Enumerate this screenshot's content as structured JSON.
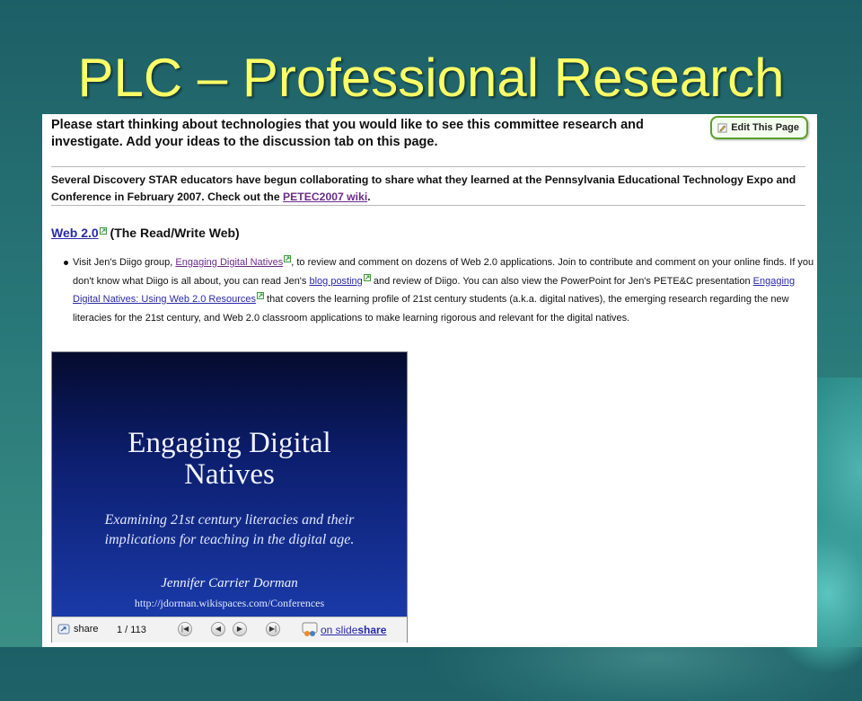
{
  "slide": {
    "title": "PLC – Professional Research"
  },
  "toolbar": {
    "edit_label": "Edit This Page"
  },
  "content": {
    "intro": "Please start thinking about technologies that you would like to see this committee research and investigate. Add your ideas to the discussion tab on this page.",
    "para2_before": "Several Discovery STAR educators have begun collaborating to share what they learned at the Pennsylvania Educational Technology Expo and Conference in February 2007. Check out the ",
    "para2_link": "PETEC2007 wiki",
    "para2_after": ".",
    "web20_link": "Web 2.0",
    "web20_rest": " (The Read/Write Web)",
    "bullet": {
      "t1": "Visit Jen's Diigo group, ",
      "l1": "Engaging Digital Natives",
      "t2": ", to review and comment on dozens of Web 2.0 applications. Join to contribute and comment on your online finds. If you don't know what Diigo is all about, you can read Jen's ",
      "l2": "blog posting",
      "t3": " and review of Diigo. You can also view the PowerPoint for Jen's PETE&C presentation ",
      "l3": "Engaging Digital Natives: Using Web 2.0 Resources",
      "t4": " that covers the learning profile of 21st century students (a.k.a. digital natives), the emerging research regarding the new literacies for the 21st century, and Web 2.0 classroom applications to make learning rigorous and relevant for the digital natives."
    }
  },
  "viewer": {
    "slide_title_line1": "Engaging Digital",
    "slide_title_line2": "Natives",
    "slide_sub_line1": "Examining 21st century literacies and their",
    "slide_sub_line2": "implications for teaching in the digital age.",
    "author": "Jennifer Carrier Dorman",
    "url": "http://jdorman.wikispaces.com/Conferences",
    "share_label": "share",
    "counter": "1 / 113",
    "ss_on": "on slide",
    "ss_share": "share"
  },
  "colors": {
    "title": "#ffff66",
    "link": "#2a2aa8",
    "visited_link": "#6a2c8a",
    "edit_border": "#5aa02c"
  }
}
